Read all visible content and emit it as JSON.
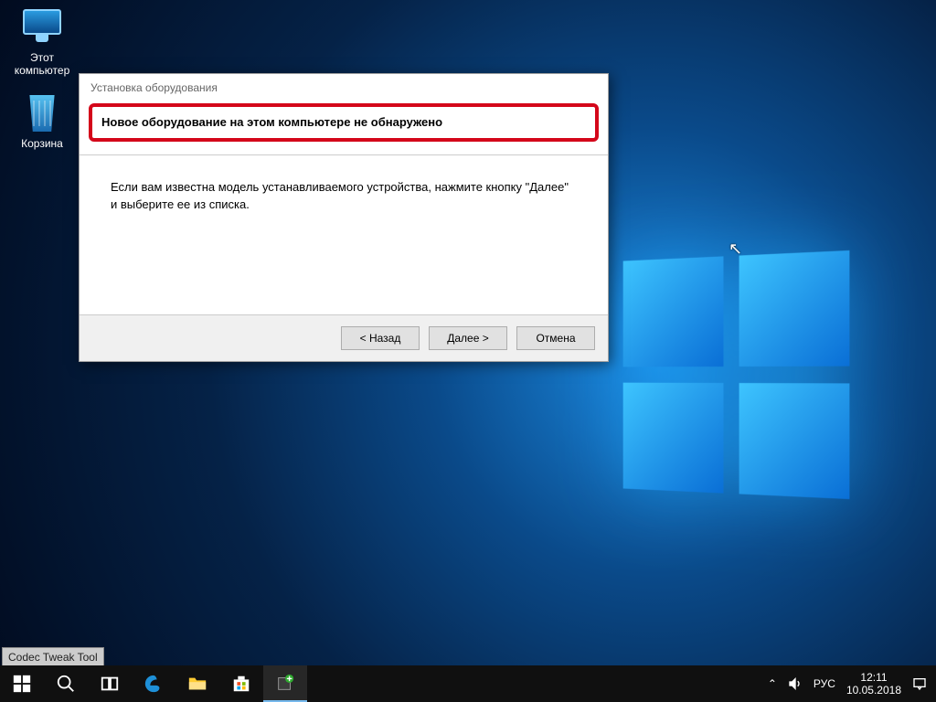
{
  "desktop": {
    "icons": {
      "this_pc": "Этот компьютер",
      "recycle_bin": "Корзина"
    },
    "tooltip": "Codec Tweak Tool"
  },
  "dialog": {
    "title": "Установка оборудования",
    "headline": "Новое оборудование на этом компьютере не обнаружено",
    "body": "Если вам известна модель устанавливаемого устройства, нажмите кнопку \"Далее\" и выберите ее из списка.",
    "buttons": {
      "back": "< Назад",
      "next": "Далее >",
      "cancel": "Отмена"
    }
  },
  "taskbar": {
    "items": {
      "start": "start",
      "search": "search",
      "taskview": "taskview",
      "edge": "edge",
      "explorer": "explorer",
      "store": "store",
      "app": "app"
    },
    "tray": {
      "lang": "РУС",
      "time": "12:11",
      "date": "10.05.2018"
    }
  }
}
